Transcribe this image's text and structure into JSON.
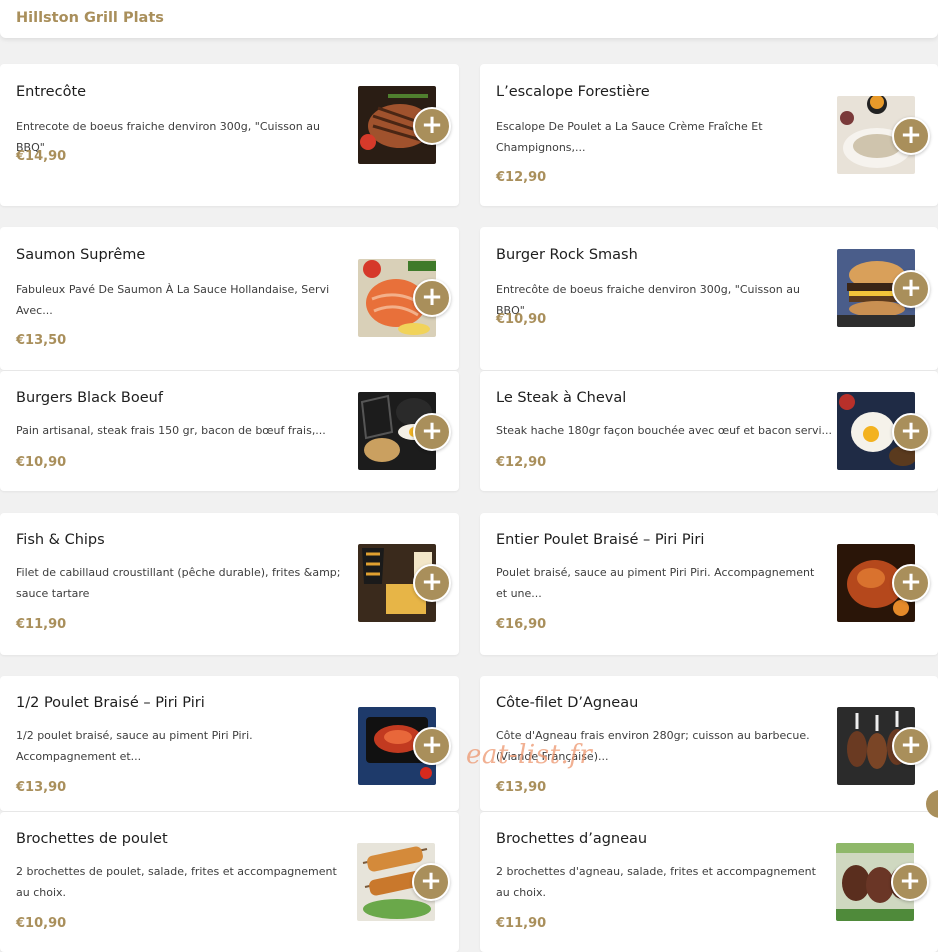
{
  "header": {
    "title": "Hillston Grill Plats"
  },
  "items": [
    {
      "name": "Entrecôte",
      "desc": "Entrecote de boeus fraiche denviron 300g, \"Cuisson au BBQ\"",
      "price": "€14,90",
      "image_icon": "grilled-steak-icon",
      "add_icon": "plus-icon"
    },
    {
      "name": "L’escalope Forestière",
      "desc": "Escalope De Poulet a La Sauce Crème Fraîche Et Champignons,...",
      "price": "€12,90",
      "image_icon": "escalope-plate-icon",
      "add_icon": "plus-icon"
    },
    {
      "name": "Saumon Suprême",
      "desc": "Fabuleux Pavé De Saumon À La Sauce Hollandaise, Servi Avec...",
      "price": "€13,50",
      "image_icon": "salmon-icon",
      "add_icon": "plus-icon"
    },
    {
      "name": "Burger Rock Smash",
      "desc": "Entrecôte de boeus fraiche denviron 300g, \"Cuisson au BBQ\"",
      "price": "€10,90",
      "image_icon": "burger-icon",
      "add_icon": "plus-icon"
    },
    {
      "name": "Burgers Black Boeuf",
      "desc": "Pain artisanal, steak frais 150 gr, bacon de bœuf frais,...",
      "price": "€10,90",
      "image_icon": "black-burger-icon",
      "add_icon": "plus-icon"
    },
    {
      "name": "Le Steak à Cheval",
      "desc": "Steak hache 180gr façon bouchée avec œuf et bacon servi...",
      "price": "€12,90",
      "image_icon": "steak-egg-icon",
      "add_icon": "plus-icon"
    },
    {
      "name": "Fish & Chips",
      "desc": "Filet de cabillaud croustillant (pêche durable), frites &amp; sauce tartare",
      "price": "€11,90",
      "image_icon": "fish-chips-icon",
      "add_icon": "plus-icon"
    },
    {
      "name": "Entier Poulet Braisé – Piri Piri",
      "desc": "Poulet braisé, sauce au piment Piri Piri. Accompagnement et une...",
      "price": "€16,90",
      "image_icon": "roast-chicken-icon",
      "add_icon": "plus-icon"
    },
    {
      "name": "1/2 Poulet Braisé – Piri Piri",
      "desc": "1/2 poulet braisé, sauce au piment Piri Piri. Accompagnement et...",
      "price": "€13,90",
      "image_icon": "half-chicken-icon",
      "add_icon": "plus-icon"
    },
    {
      "name": "Côte-filet D’Agneau",
      "desc": "Côte d'Agneau frais environ 280gr; cuisson au barbecue. (Viande Française)...",
      "price": "€13,90",
      "image_icon": "lamb-chops-icon",
      "add_icon": "plus-icon"
    },
    {
      "name": "Brochettes de poulet",
      "desc": "2 brochettes de poulet, salade, frites et accompagnement au choix.",
      "price": "€10,90",
      "image_icon": "chicken-skewers-icon",
      "add_icon": "plus-icon"
    },
    {
      "name": "Brochettes d’agneau",
      "desc": "2 brochettes d'agneau, salade, frites et accompagnement au choix.",
      "price": "€11,90",
      "image_icon": "lamb-skewers-icon",
      "add_icon": "plus-icon"
    }
  ],
  "watermark": "eat-list.fr",
  "colors": {
    "accent": "#a98f5b",
    "background": "#f1f1f1",
    "card": "#ffffff",
    "watermark": "#ec966e"
  }
}
